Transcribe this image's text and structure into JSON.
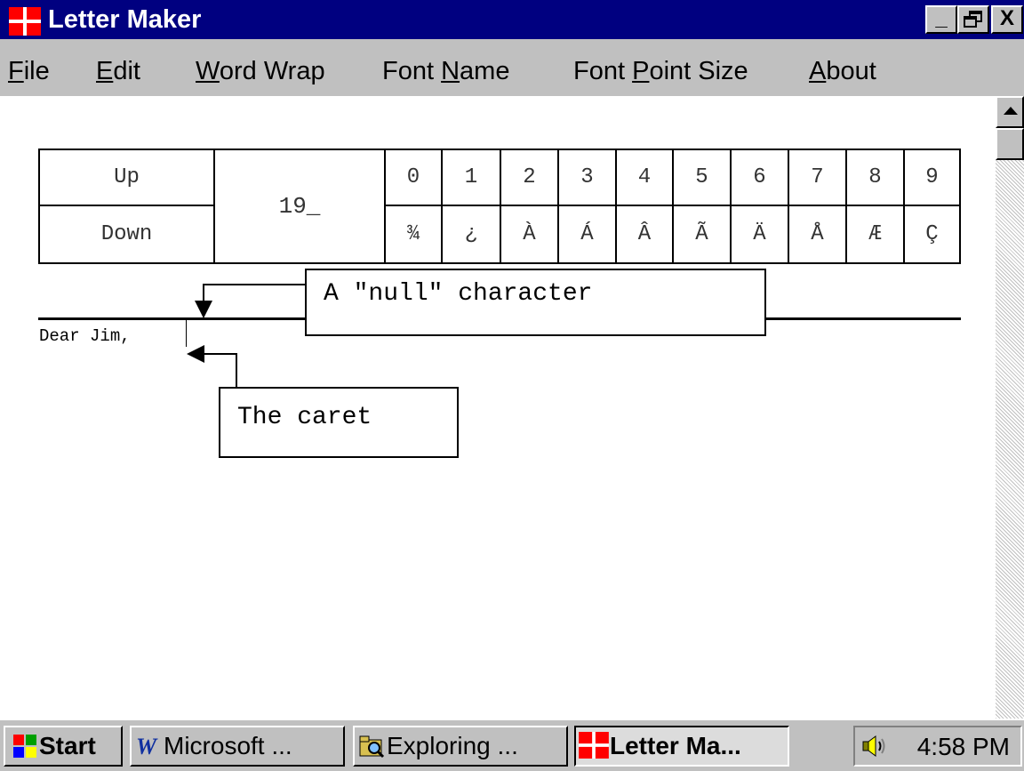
{
  "window": {
    "title": "Letter Maker"
  },
  "title_buttons": {
    "minimize": "_",
    "close": "X"
  },
  "menu": [
    {
      "label": "File",
      "mnemonic": "F",
      "rest": "ile"
    },
    {
      "label": "Edit",
      "mnemonic": "E",
      "rest": "dit"
    },
    {
      "label": "Word Wrap",
      "mnemonic": "W",
      "rest": "ord Wrap"
    },
    {
      "label": "Font Name",
      "pre": "Font ",
      "mnemonic": "N",
      "rest": "ame"
    },
    {
      "label": "Font Point Size",
      "pre": "Font ",
      "mnemonic": "P",
      "rest": "oint Size"
    },
    {
      "label": "About",
      "mnemonic": "A",
      "rest": "bout"
    }
  ],
  "picker": {
    "up_label": "Up",
    "down_label": "Down",
    "code": "19_",
    "digits": [
      "0",
      "1",
      "2",
      "3",
      "4",
      "5",
      "6",
      "7",
      "8",
      "9"
    ],
    "chars": [
      "¾",
      "¿",
      "À",
      "Á",
      "Â",
      "Ã",
      "Ä",
      "Å",
      "Æ",
      "Ç"
    ]
  },
  "document": {
    "text": "Dear Jim,"
  },
  "callouts": {
    "null_char": "A \"null\" character",
    "caret": "The caret"
  },
  "taskbar": {
    "start": "Start",
    "buttons": [
      "Microsoft ...",
      "Exploring ...",
      "Letter Ma..."
    ],
    "clock": "4:58 PM"
  },
  "colors": {
    "titlebar": "#000080",
    "face": "#c0c0c0",
    "icon_red": "#ff0000"
  }
}
